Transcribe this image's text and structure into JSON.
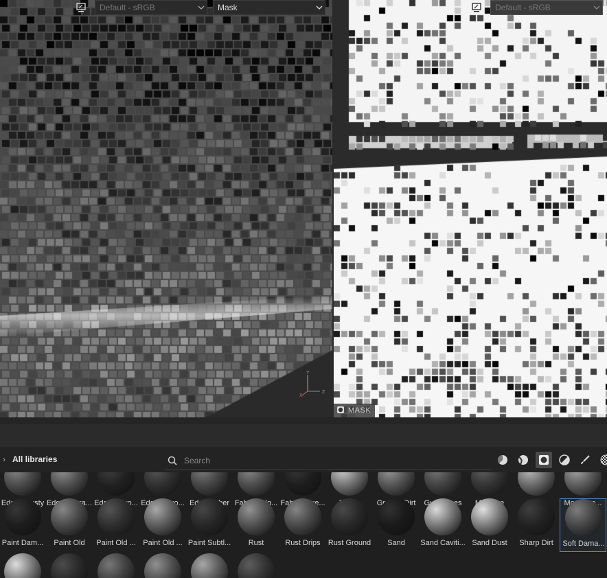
{
  "viewport3d": {
    "colorspace_value": "Default - sRGB",
    "channel_value": "Mask"
  },
  "viewport2d": {
    "colorspace_value": "Default - sRGB",
    "channel_badge": "MASK"
  },
  "axis": {
    "y": "Y",
    "z": "Z",
    "x": "X"
  },
  "shelf": {
    "title": "All libraries",
    "search_placeholder": "Search",
    "filters": [
      "materials",
      "smart-materials",
      "smart-masks",
      "filters",
      "brushes",
      "textures"
    ],
    "active_filter": "smart-masks",
    "rows": [
      [
        "Edges Dusty",
        "Edges Scra...",
        "Edges Stro...",
        "Edges Stro...",
        "Edges Uber",
        "Fabric Edg...",
        "Fabric Thre...",
        "Fibers",
        "Ground Dirt",
        "Gun Edges",
        "Moisture",
        "Moss",
        "Moss Fro..."
      ],
      [
        "Paint Dam...",
        "Paint Old",
        "Paint Old ...",
        "Paint Old ...",
        "Paint Subtl...",
        "Rust",
        "Rust Drips",
        "Rust Ground",
        "Sand",
        "Sand Caviti...",
        "Sand Dust",
        "Sharp Dirt",
        "Soft Dama..."
      ],
      [
        "",
        "",
        "",
        "",
        "",
        ""
      ]
    ],
    "selected": "Soft Dama..."
  },
  "colors": {
    "accent": "#4f86c6",
    "panel": "#232323",
    "text": "#d8d8d8"
  }
}
